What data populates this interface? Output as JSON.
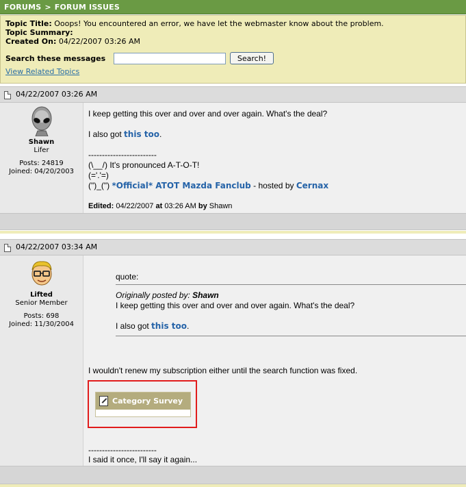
{
  "breadcrumb": {
    "root": "FORUMS",
    "separator": ">",
    "current": "FORUM ISSUES"
  },
  "topic": {
    "title_label": "Topic Title:",
    "title_value": "Ooops! You encountered an error, we have let the webmaster know about the problem.",
    "summary_label": "Topic Summary:",
    "summary_value": "",
    "created_label": "Created On:",
    "created_value": "04/22/2007 03:26 AM",
    "search_label": "Search these messages",
    "search_value": "",
    "search_button": "Search!",
    "related_link": "View Related Topics"
  },
  "posts": [
    {
      "timestamp": "04/22/2007 03:26 AM",
      "user": {
        "name": "Shawn",
        "title": "Lifer",
        "posts": "Posts: 24819",
        "joined": "Joined: 04/20/2003",
        "avatar": "alien-avatar"
      },
      "body_line1": "I keep getting this over and over and over again. What's the deal?",
      "body_line2_prefix": "I also got",
      "body_line2_link": "this too",
      "body_line2_suffix": ".",
      "sig_rule": "-------------------------",
      "sig_line1": "(\\__/) It's pronounced A-T-O-T!",
      "sig_line2": "(='.'=)",
      "sig_line3_prefix": "(\")_(\")",
      "sig_line3_link": "*Official* ATOT Mazda Fanclub",
      "sig_line3_mid": "- hosted by",
      "sig_line3_link2": "Cernax",
      "edited_label": "Edited:",
      "edited_date": "04/22/2007",
      "edited_at": "at",
      "edited_time": "03:26 AM",
      "edited_by": "by",
      "edited_user": "Shawn"
    },
    {
      "timestamp": "04/22/2007 03:34 AM",
      "user": {
        "name": "Lifted",
        "title": "Senior Member",
        "posts": "Posts: 698",
        "joined": "Joined: 11/30/2004",
        "avatar": "glasses-avatar"
      },
      "quote_label": "quote:",
      "quote_posted_by": "Originally posted by:",
      "quote_author": "Shawn",
      "quote_line1": "I keep getting this over and over and over again. What's the deal?",
      "quote_line2_prefix": "I also got",
      "quote_line2_link": "this too",
      "quote_line2_suffix": ".",
      "body_line": "I wouldn't renew my subscription either until the search function was fixed.",
      "survey_label": "Category Survey",
      "sig_rule": "-------------------------",
      "sig_line": "I said it once, I'll say it again..."
    }
  ],
  "colors": {
    "breadcrumb_bg": "#6a9a44",
    "summary_bg": "#efecb8",
    "link": "#2563a8",
    "highlight_border": "#e11b1b",
    "survey_header": "#b4ac7e"
  }
}
